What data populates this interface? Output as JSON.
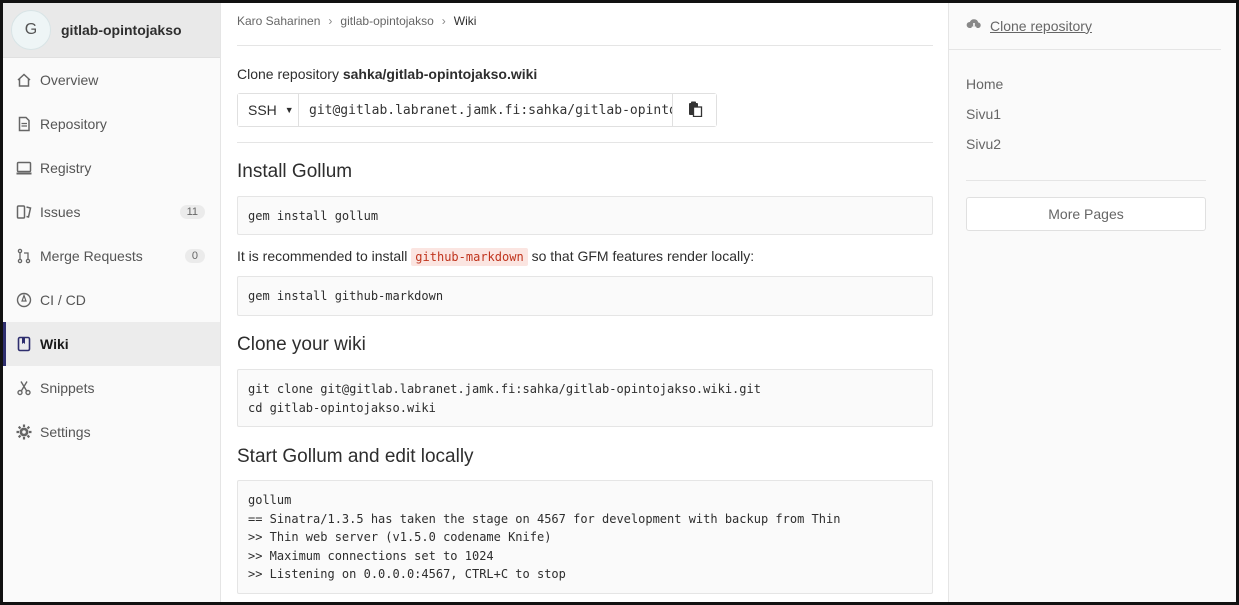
{
  "project": {
    "avatar_letter": "G",
    "name": "gitlab-opintojakso"
  },
  "sidebar": {
    "items": [
      {
        "label": "Overview",
        "icon": "home-icon"
      },
      {
        "label": "Repository",
        "icon": "doc-icon"
      },
      {
        "label": "Registry",
        "icon": "container-icon"
      },
      {
        "label": "Issues",
        "icon": "issues-icon",
        "badge": "11"
      },
      {
        "label": "Merge Requests",
        "icon": "merge-icon",
        "badge": "0"
      },
      {
        "label": "CI / CD",
        "icon": "rocket-icon"
      },
      {
        "label": "Wiki",
        "icon": "book-icon",
        "active": true
      },
      {
        "label": "Snippets",
        "icon": "scissors-icon"
      },
      {
        "label": "Settings",
        "icon": "gear-icon"
      }
    ]
  },
  "breadcrumb": {
    "user": "Karo Saharinen",
    "project": "gitlab-opintojakso",
    "current": "Wiki"
  },
  "clone": {
    "title_prefix": "Clone repository",
    "repo": "sahka/gitlab-opintojakso.wiki",
    "protocol": "SSH",
    "url": "git@gitlab.labranet.jamk.fi:sahka/gitlab-opintojakso.wiki.git"
  },
  "sections": {
    "install_title": "Install Gollum",
    "install_code": "gem install gollum",
    "recommend_prefix": "It is recommended to install",
    "recommend_code": "github-markdown",
    "recommend_suffix": "so that GFM features render locally:",
    "markdown_code": "gem install github-markdown",
    "clone_title": "Clone your wiki",
    "clone_code": "git clone git@gitlab.labranet.jamk.fi:sahka/gitlab-opintojakso.wiki.git\ncd gitlab-opintojakso.wiki",
    "start_title": "Start Gollum and edit locally",
    "start_code": "gollum\n== Sinatra/1.3.5 has taken the stage on 4567 for development with backup from Thin\n>> Thin web server (v1.5.0 codename Knife)\n>> Maximum connections set to 1024\n>> Listening on 0.0.0.0:4567, CTRL+C to stop"
  },
  "right_sidebar": {
    "clone_link": "Clone repository",
    "pages": [
      "Home",
      "Sivu1",
      "Sivu2"
    ],
    "more_pages": "More Pages"
  },
  "colors": {
    "active_indicator": "#2e2e6e",
    "code_highlight": "#c0341d",
    "code_highlight_bg": "#fbe5e1"
  }
}
